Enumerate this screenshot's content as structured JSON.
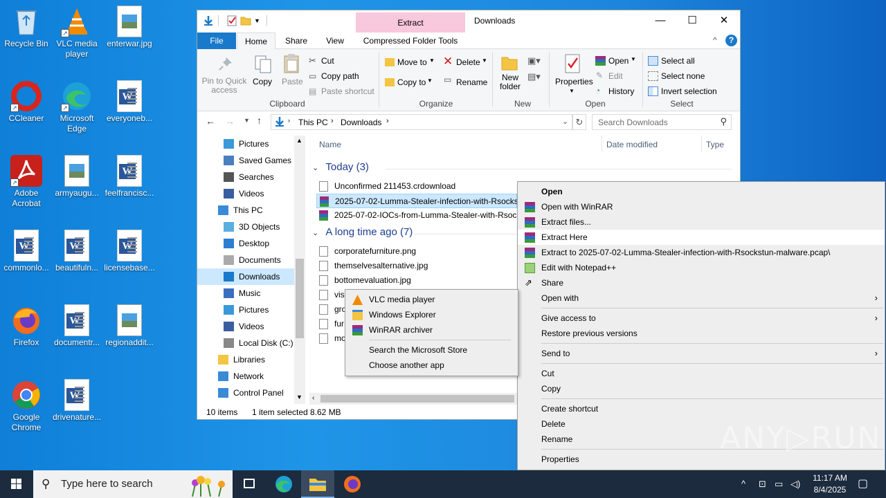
{
  "desktop": {
    "icons": [
      {
        "label": "Recycle Bin"
      },
      {
        "label": "VLC media player"
      },
      {
        "label": "enterwar.jpg"
      },
      {
        "label": "CCleaner"
      },
      {
        "label": "Microsoft Edge"
      },
      {
        "label": "everyoneb..."
      },
      {
        "label": "Adobe Acrobat"
      },
      {
        "label": "armyaugu..."
      },
      {
        "label": "feelfrancisc..."
      },
      {
        "label": "commonlo..."
      },
      {
        "label": "beautifuln..."
      },
      {
        "label": "licensebase..."
      },
      {
        "label": "Firefox"
      },
      {
        "label": "documentr..."
      },
      {
        "label": "regionaddit..."
      },
      {
        "label": "Google Chrome"
      },
      {
        "label": "drivenature..."
      }
    ]
  },
  "explorer": {
    "title": "Downloads",
    "context_tab": "Extract",
    "window_controls": {
      "minimize": "—",
      "maximize": "☐",
      "close": "✕"
    },
    "tabs": [
      "File",
      "Home",
      "Share",
      "View",
      "Compressed Folder Tools"
    ],
    "ribbon": {
      "clipboard": {
        "pin": "Pin to Quick access",
        "copy": "Copy",
        "paste": "Paste",
        "cut": "Cut",
        "copy_path": "Copy path",
        "paste_shortcut": "Paste shortcut",
        "group": "Clipboard"
      },
      "organize": {
        "move_to": "Move to",
        "copy_to": "Copy to",
        "delete": "Delete",
        "rename": "Rename",
        "group": "Organize"
      },
      "new": {
        "new_folder": "New folder",
        "group": "New"
      },
      "open": {
        "properties": "Properties",
        "open": "Open",
        "edit": "Edit",
        "history": "History",
        "group": "Open"
      },
      "select": {
        "select_all": "Select all",
        "select_none": "Select none",
        "invert": "Invert selection",
        "group": "Select"
      }
    },
    "address": {
      "this_pc": "This PC",
      "downloads": "Downloads",
      "search_placeholder": "Search Downloads"
    },
    "nav": [
      "Pictures",
      "Saved Games",
      "Searches",
      "Videos",
      "This PC",
      "3D Objects",
      "Desktop",
      "Documents",
      "Downloads",
      "Music",
      "Pictures",
      "Videos",
      "Local Disk (C:)",
      "Libraries",
      "Network",
      "Control Panel"
    ],
    "columns": {
      "name": "Name",
      "date": "Date modified",
      "type": "Type"
    },
    "groups": {
      "today": "Today (3)",
      "long_ago": "A long time ago (7)"
    },
    "files_today": [
      "Unconfirmed 211453.crdownload",
      "2025-07-02-Lumma-Stealer-infection-with-Rsocks",
      "2025-07-02-IOCs-from-Lumma-Stealer-with-Rsocl"
    ],
    "files_old": [
      "corporatefurniture.png",
      "themselvesalternative.jpg",
      "bottomevaluation.jpg",
      "visi",
      "gro",
      "fur",
      "mo"
    ],
    "status": {
      "count": "10 items",
      "selected": "1 item selected",
      "size": "8.62 MB"
    }
  },
  "context_menu": {
    "items": [
      "Open",
      "Open with WinRAR",
      "Extract files...",
      "Extract Here",
      "Extract to 2025-07-02-Lumma-Stealer-infection-with-Rsockstun-malware.pcap\\",
      "Edit with Notepad++",
      "Share",
      "Open with",
      "Give access to",
      "Restore previous versions",
      "Send to",
      "Cut",
      "Copy",
      "Create shortcut",
      "Delete",
      "Rename",
      "Properties"
    ]
  },
  "submenu": {
    "items": [
      "VLC media player",
      "Windows Explorer",
      "WinRAR archiver",
      "Search the Microsoft Store",
      "Choose another app"
    ]
  },
  "taskbar": {
    "search_placeholder": "Type here to search",
    "time": "11:17 AM",
    "date": "8/4/2025"
  },
  "watermark": "ANY▷RUN",
  "colors": {
    "accent": "#1979ca",
    "selection": "#cce8ff",
    "context_tab": "#f8c8dc",
    "taskbar": "#1c2b3e"
  }
}
